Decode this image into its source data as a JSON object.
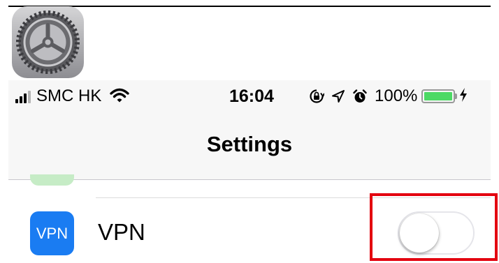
{
  "status_bar": {
    "carrier": "SMC HK",
    "time": "16:04",
    "battery_percent": "100%",
    "battery_level": 1.0,
    "signal_bars_filled": 3,
    "signal_bars_total": 4,
    "icons": [
      "signal-icon",
      "wifi-icon",
      "orientation-lock-icon",
      "location-icon",
      "alarm-icon",
      "battery-icon",
      "charging-bolt-icon"
    ]
  },
  "nav": {
    "title": "Settings"
  },
  "rows": [
    {
      "icon_text": "VPN",
      "label": "VPN",
      "toggle_on": false
    }
  ],
  "colors": {
    "vpn_icon": "#1a7cf2",
    "battery_fill": "#4cd964",
    "highlight": "#e3000f"
  }
}
